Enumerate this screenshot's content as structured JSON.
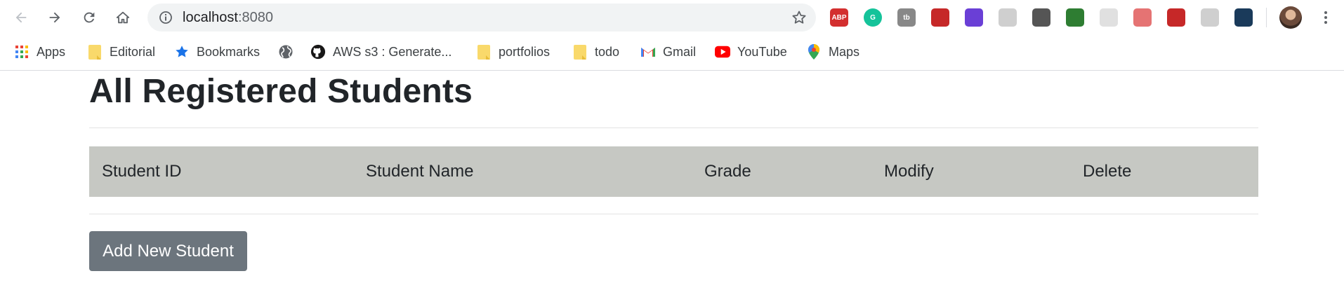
{
  "browser": {
    "url_host": "localhost",
    "url_port": ":8080",
    "extensions": [
      {
        "name": "adblock-plus-icon",
        "label": "ABP",
        "color": "#d32f2f"
      },
      {
        "name": "grammarly-icon",
        "label": "G",
        "color": "#15c39a"
      },
      {
        "name": "extension-tb-icon",
        "label": "tb",
        "color": "#888888"
      },
      {
        "name": "pocket-icon",
        "label": "",
        "color": "#c62828"
      },
      {
        "name": "extension-puzzle-purple-icon",
        "label": "",
        "color": "#6a3fd6"
      },
      {
        "name": "extension-circle-icon",
        "label": "",
        "color": "#cfcfcf"
      },
      {
        "name": "lightbulb-icon",
        "label": "",
        "color": "#555555"
      },
      {
        "name": "globe-extension-icon",
        "label": "",
        "color": "#2e7d32"
      },
      {
        "name": "extension-gray-icon",
        "label": "",
        "color": "#e0e0e0"
      },
      {
        "name": "face-glasses-icon",
        "label": "",
        "color": "#e57373"
      },
      {
        "name": "rocket-icon",
        "label": "",
        "color": "#c62828"
      },
      {
        "name": "extension-chat-icon",
        "label": "",
        "color": "#cfcfcf"
      },
      {
        "name": "extension-dark-icon",
        "label": "",
        "color": "#1a3a5a"
      }
    ]
  },
  "bookmarks": [
    {
      "name": "bookmark-apps",
      "label": "Apps",
      "icon": "apps-grid-icon"
    },
    {
      "name": "bookmark-editorial",
      "label": "Editorial",
      "icon": "folder-icon"
    },
    {
      "name": "bookmark-bookmarks",
      "label": "Bookmarks",
      "icon": "star-icon"
    },
    {
      "name": "bookmark-globe",
      "label": "",
      "icon": "globe-icon"
    },
    {
      "name": "bookmark-aws",
      "label": "AWS s3 : Generate...",
      "icon": "github-icon"
    },
    {
      "name": "bookmark-portfolios",
      "label": "portfolios",
      "icon": "folder-icon"
    },
    {
      "name": "bookmark-todo",
      "label": "todo",
      "icon": "folder-icon"
    },
    {
      "name": "bookmark-gmail",
      "label": "Gmail",
      "icon": "gmail-icon"
    },
    {
      "name": "bookmark-youtube",
      "label": "YouTube",
      "icon": "youtube-icon"
    },
    {
      "name": "bookmark-maps",
      "label": "Maps",
      "icon": "maps-icon"
    }
  ],
  "page": {
    "title": "All Registered Students",
    "table": {
      "columns": [
        "Student ID",
        "Student Name",
        "Grade",
        "Modify",
        "Delete"
      ],
      "rows": []
    },
    "add_button_label": "Add New Student"
  },
  "colors": {
    "table_header_bg": "#c6c8c3",
    "button_bg": "#6c757d"
  }
}
